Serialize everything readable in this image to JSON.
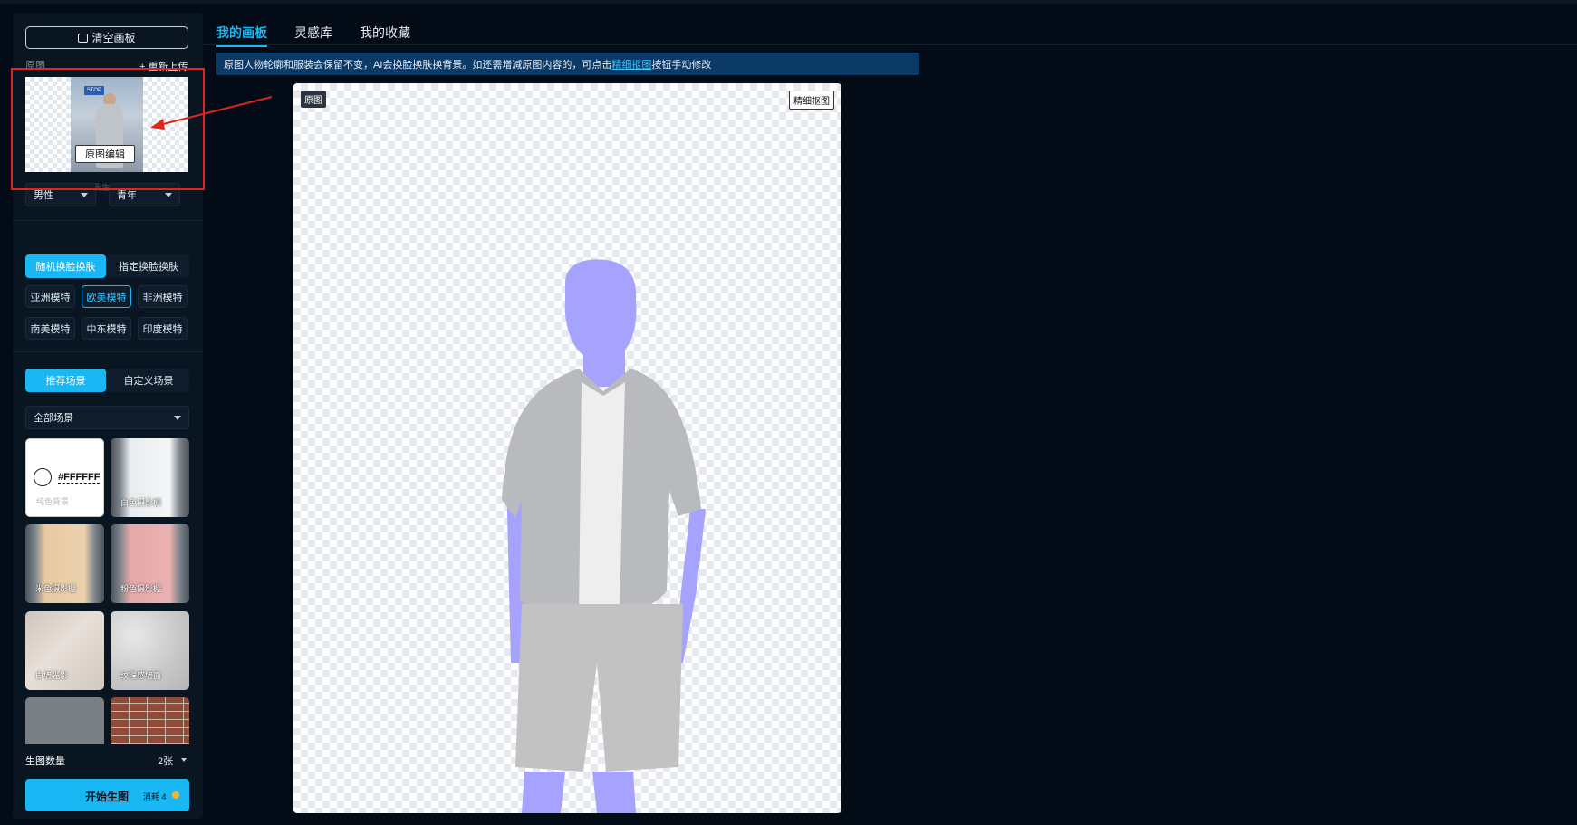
{
  "sidebar": {
    "clear_label": "清空画板",
    "orig_label": "原图",
    "reupload_label": "+ 重新上传",
    "thumb_sign": "STOP",
    "edit_label": "原图编辑",
    "hint": "*生成图会按原图比例生成",
    "gender": "男性",
    "age": "青年",
    "face_mode_on": "随机换脸换肤",
    "face_mode_off": "指定换脸换肤",
    "models": [
      "亚洲模特",
      "欧美模特",
      "非洲模特",
      "南美模特",
      "中东模特",
      "印度模特"
    ],
    "active_model": "欧美模特",
    "scene_mode_on": "推荐场景",
    "scene_mode_off": "自定义场景",
    "scene_filter": "全部场景",
    "scenes": [
      {
        "label": "纯色背景",
        "hex": "#FFFFFF"
      },
      {
        "label": "白色摄影棚"
      },
      {
        "label": "米色摄影棚"
      },
      {
        "label": "粉色摄影棚"
      },
      {
        "label": "白墙光影"
      },
      {
        "label": "纹理感墙面"
      }
    ],
    "gen_count_label": "生图数量",
    "gen_count_value": "2张",
    "start_label": "开始生图",
    "cost_label": "消耗 4"
  },
  "main": {
    "tabs": [
      "我的画板",
      "灵感库",
      "我的收藏"
    ],
    "active_tab": "我的画板",
    "notice_text_1": "原图人物轮廓和服装会保留不变，AI会换脸换肤换背景。如还需增减原图内容的，可点击",
    "notice_link": "精细抠图",
    "notice_text_2": "按钮手动修改",
    "canvas_tag": "原图",
    "refine_label": "精细抠图"
  },
  "colors": {
    "accent": "#1ab7f5",
    "background": "#020b16",
    "sidebar": "#0a1522",
    "notice": "#0b3a66",
    "skin_mask": "#a6a3ff",
    "highlight_box": "#e0251b"
  }
}
